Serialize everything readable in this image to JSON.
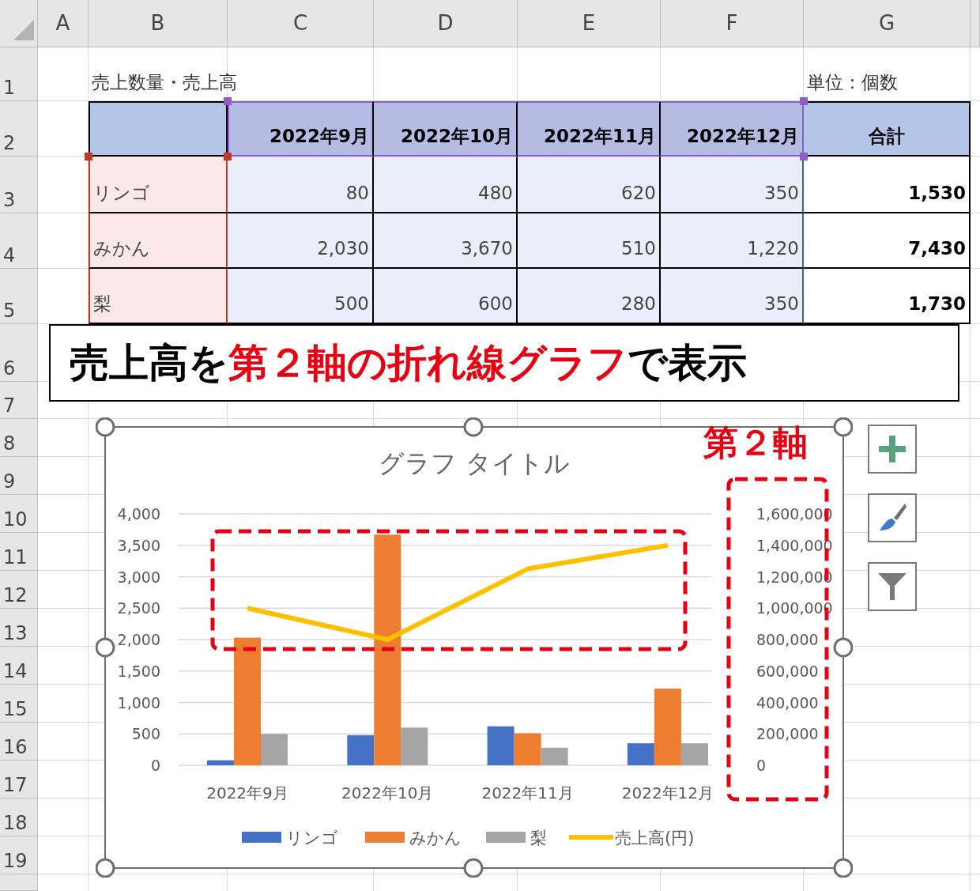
{
  "sheet": {
    "column_headers": [
      "A",
      "B",
      "C",
      "D",
      "E",
      "F",
      "G"
    ],
    "row_headers": [
      "1",
      "2",
      "3",
      "4",
      "5",
      "6",
      "7",
      "8",
      "9",
      "10",
      "11",
      "12",
      "13",
      "14",
      "15",
      "16",
      "17",
      "18",
      "19"
    ],
    "title_cell": "売上数量・売上高",
    "unit_cell": "単位：個数",
    "table": {
      "columns": [
        "2022年9月",
        "2022年10月",
        "2022年11月",
        "2022年12月"
      ],
      "total_header": "合計",
      "rows": [
        {
          "name": "リンゴ",
          "values": [
            "80",
            "480",
            "620",
            "350"
          ],
          "total": "1,530"
        },
        {
          "name": "みかん",
          "values": [
            "2,030",
            "3,670",
            "510",
            "1,220"
          ],
          "total": "7,430"
        },
        {
          "name": "梨",
          "values": [
            "500",
            "600",
            "280",
            "350"
          ],
          "total": "1,730"
        }
      ]
    }
  },
  "banner": {
    "parts": [
      {
        "text": "売上高を",
        "highlight": false
      },
      {
        "text": "第２軸の折れ線グラフ",
        "highlight": true
      },
      {
        "text": "で表示",
        "highlight": false
      }
    ]
  },
  "callout": "第２軸",
  "chart": {
    "chart_data": {
      "type": "bar",
      "title": "グラフ タイトル",
      "categories": [
        "2022年9月",
        "2022年10月",
        "2022年11月",
        "2022年12月"
      ],
      "series": [
        {
          "name": "リンゴ",
          "color": "#4472c4",
          "values": [
            80,
            480,
            620,
            350
          ]
        },
        {
          "name": "みかん",
          "color": "#ed7d31",
          "values": [
            2030,
            3670,
            510,
            1220
          ]
        },
        {
          "name": "梨",
          "color": "#a5a5a5",
          "values": [
            500,
            600,
            280,
            350
          ]
        },
        {
          "name": "売上高(円)",
          "color": "#ffc000",
          "type": "line",
          "axis": "y2",
          "values": [
            1000000,
            800000,
            1250000,
            1400000
          ]
        }
      ],
      "grid": true,
      "legend": true,
      "ylim": [
        0,
        4000
      ],
      "yticks": [
        {
          "value": 0,
          "label": "0"
        },
        {
          "value": 500,
          "label": "500"
        },
        {
          "value": 1000,
          "label": "1,000"
        },
        {
          "value": 1500,
          "label": "1,500"
        },
        {
          "value": 2000,
          "label": "2,000"
        },
        {
          "value": 2500,
          "label": "2,500"
        },
        {
          "value": 3000,
          "label": "3,000"
        },
        {
          "value": 3500,
          "label": "3,500"
        },
        {
          "value": 4000,
          "label": "4,000"
        }
      ],
      "y2lim": [
        0,
        1600000
      ],
      "y2ticks": [
        {
          "value": 0,
          "label": "0"
        },
        {
          "value": 200000,
          "label": "200,000"
        },
        {
          "value": 400000,
          "label": "400,000"
        },
        {
          "value": 600000,
          "label": "600,000"
        },
        {
          "value": 800000,
          "label": "800,000"
        },
        {
          "value": 1000000,
          "label": "1,000,000"
        },
        {
          "value": 1200000,
          "label": "1,200,000"
        },
        {
          "value": 1400000,
          "label": "1,400,000"
        },
        {
          "value": 1600000,
          "label": "1,600,000"
        }
      ]
    }
  }
}
